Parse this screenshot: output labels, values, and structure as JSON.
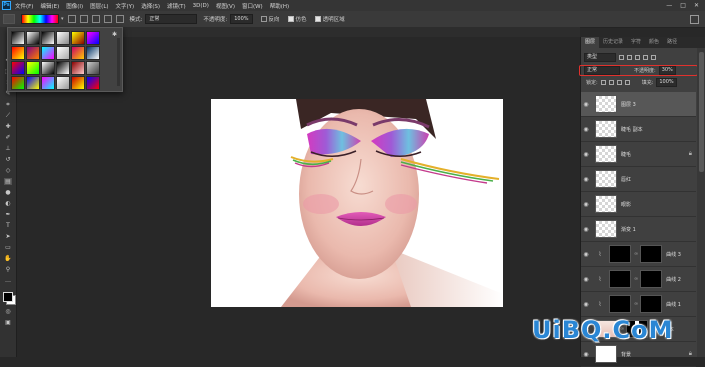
{
  "menubar": {
    "logo": "Ps",
    "items": [
      "文件(F)",
      "编辑(E)",
      "图像(I)",
      "图层(L)",
      "文字(Y)",
      "选择(S)",
      "滤镜(T)",
      "3D(D)",
      "视图(V)",
      "窗口(W)",
      "帮助(H)"
    ],
    "window_controls": [
      "—",
      "□",
      "✕"
    ]
  },
  "options": {
    "mode_label": "模式:",
    "mode_value": "正常",
    "opacity_label": "不透明度:",
    "opacity_value": "100%",
    "reverse_label": "反向",
    "dither_label": "仿色",
    "transparency_label": "透明区域"
  },
  "document_tab": "× ",
  "panels": {
    "tabs": [
      "图层",
      "历史记录",
      "字符",
      "颜色",
      "路径"
    ],
    "active_tab_index": 0,
    "filter_kind": "类型",
    "blend_mode": "正常",
    "opacity_label": "不透明度:",
    "opacity_value": "30%",
    "lock_label": "锁定:",
    "fill_label": "填充:",
    "fill_value": "100%",
    "layers": [
      {
        "name": "图层 3",
        "thumb": "transparent",
        "selected": true,
        "lock": false,
        "adjust": false
      },
      {
        "name": "睫毛 副本",
        "thumb": "transparent",
        "selected": false,
        "lock": false,
        "adjust": false
      },
      {
        "name": "睫毛",
        "thumb": "transparent",
        "selected": false,
        "lock": true,
        "adjust": false
      },
      {
        "name": "唇红",
        "thumb": "transparent",
        "selected": false,
        "lock": false,
        "adjust": false
      },
      {
        "name": "眼影",
        "thumb": "transparent",
        "selected": false,
        "lock": false,
        "adjust": false
      },
      {
        "name": "渐变 1",
        "thumb": "transparent",
        "selected": false,
        "lock": false,
        "adjust": false
      },
      {
        "name": "曲线 3",
        "thumb": "mask",
        "selected": false,
        "lock": false,
        "adjust": true
      },
      {
        "name": "曲线 2",
        "thumb": "mask",
        "selected": false,
        "lock": false,
        "adjust": true
      },
      {
        "name": "曲线 1",
        "thumb": "mask",
        "selected": false,
        "lock": false,
        "adjust": true
      },
      {
        "name": "背景 副本",
        "thumb": "face",
        "selected": false,
        "lock": false,
        "adjust": false
      },
      {
        "name": "背景",
        "thumb": "solid",
        "selected": false,
        "lock": true,
        "adjust": false
      }
    ]
  },
  "gradient_presets": [
    [
      "#000",
      "#fff"
    ],
    [
      "#fff",
      "#000"
    ],
    [
      "#000",
      "#fff"
    ],
    [
      "#fff",
      "#888"
    ],
    [
      "#ff0",
      "#800"
    ],
    [
      "#f0f",
      "#00f"
    ],
    [
      "#f00",
      "#ff0"
    ],
    [
      "#800080",
      "#ff8000"
    ],
    [
      "#0ff",
      "#f0f"
    ],
    [
      "#fff",
      "#aaa"
    ],
    [
      "#c06",
      "#fc0"
    ],
    [
      "#036",
      "#fff"
    ],
    [
      "#f00",
      "#00f"
    ],
    [
      "#ff0",
      "#0f0"
    ],
    [
      "#fff",
      "#000"
    ],
    [
      "#000",
      "#fff"
    ],
    [
      "#800",
      "#fcc"
    ],
    [
      "#ccc",
      "#444"
    ],
    [
      "#f00",
      "#0f0"
    ],
    [
      "#00f",
      "#ff0"
    ],
    [
      "#f0f",
      "#0ff"
    ],
    [
      "#fff",
      "#999"
    ],
    [
      "#c00",
      "#ff0"
    ],
    [
      "#00f",
      "#f00"
    ]
  ],
  "watermark": "UiBQ.CoM"
}
